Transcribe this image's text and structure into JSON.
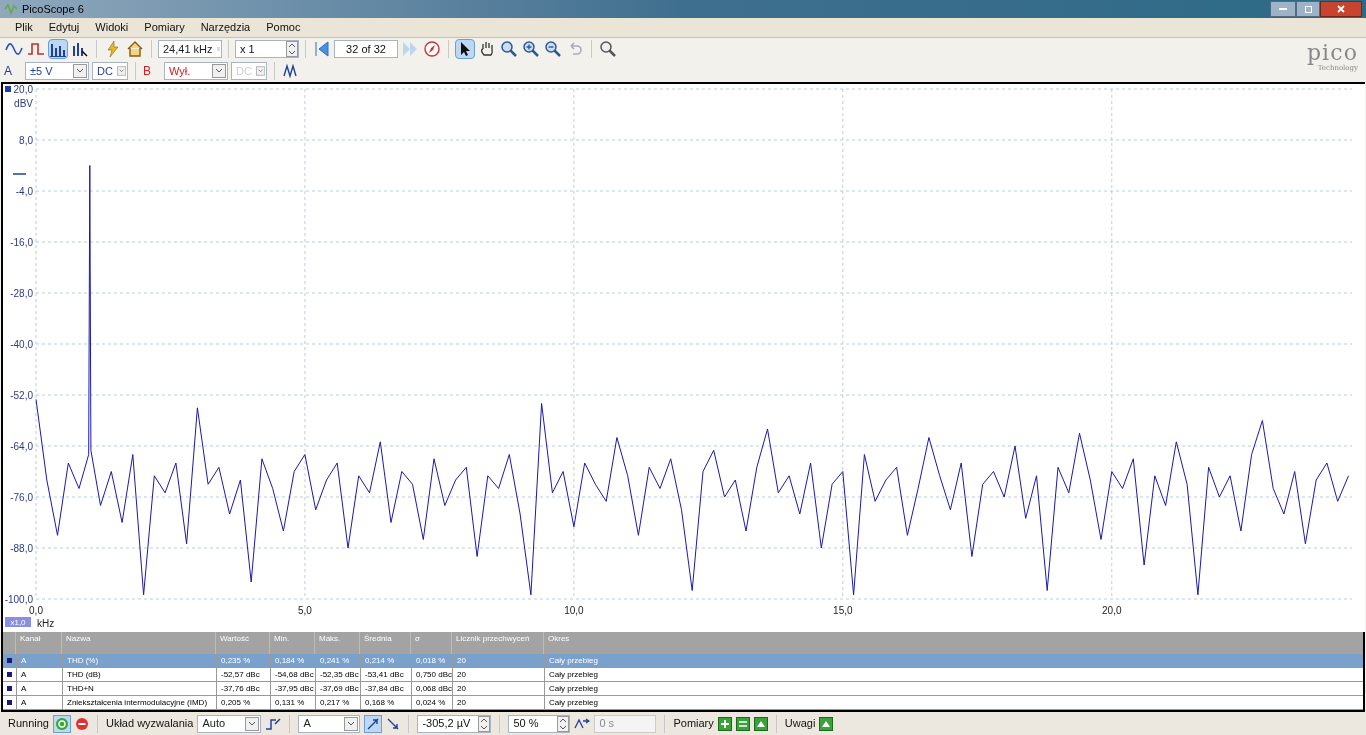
{
  "window": {
    "title": "PicoScope 6"
  },
  "menu": [
    "Plik",
    "Edytuj",
    "Widoki",
    "Pomiary",
    "Narzędzia",
    "Pomoc"
  ],
  "toolbar": {
    "modes": [
      {
        "kind": "scope",
        "selected": false
      },
      {
        "kind": "persistence",
        "selected": false
      },
      {
        "kind": "spectrum",
        "selected": true
      }
    ],
    "timebase": "24,41 kHz",
    "zoom": "x 1",
    "buffer": "32 of 32",
    "tools": [
      {
        "kind": "pointer",
        "selected": true
      },
      {
        "kind": "hand",
        "selected": false
      },
      {
        "kind": "zoom",
        "selected": false
      },
      {
        "kind": "zoom-in",
        "selected": false
      },
      {
        "kind": "zoom-out",
        "selected": false
      },
      {
        "kind": "undo",
        "selected": false
      }
    ]
  },
  "channels": [
    {
      "name": "A",
      "color": "#1e3fa0",
      "range": "±5 V",
      "coupling": "DC",
      "coupling_disabled": false
    },
    {
      "name": "B",
      "color": "#cc2222",
      "range": "Wył.",
      "coupling": "DC",
      "coupling_disabled": true
    }
  ],
  "logo": {
    "name": "pico",
    "tagline": "Technology"
  },
  "plot": {
    "zoom_badge": "x1,0",
    "chart_data": {
      "type": "line",
      "grid": true,
      "xlabel": "kHz",
      "ylabel": "dBV",
      "xlim": [
        0,
        24.41
      ],
      "ylim": [
        -100,
        20
      ],
      "xticks": [
        {
          "value": 0,
          "label": "0,0"
        },
        {
          "value": 5,
          "label": "5,0"
        },
        {
          "value": 10,
          "label": "10,0"
        },
        {
          "value": 15,
          "label": "15,0"
        },
        {
          "value": 20,
          "label": "20,0"
        }
      ],
      "yticks": [
        {
          "value": 20,
          "label": "20,0"
        },
        {
          "value": 8,
          "label": "8,0"
        },
        {
          "value": -4,
          "label": "-4,0"
        },
        {
          "value": -16,
          "label": "-16,0"
        },
        {
          "value": -28,
          "label": "-28,0"
        },
        {
          "value": -40,
          "label": "-40,0"
        },
        {
          "value": -52,
          "label": "-52,0"
        },
        {
          "value": -64,
          "label": "-64,0"
        },
        {
          "value": -76,
          "label": "-76,0"
        },
        {
          "value": -88,
          "label": "-88,0"
        },
        {
          "value": -100,
          "label": "-100,0"
        }
      ],
      "x": [
        0,
        0.2,
        0.4,
        0.6,
        0.8,
        0.98,
        1.0,
        1.02,
        1.2,
        1.4,
        1.6,
        1.8,
        2.0,
        2.2,
        2.4,
        2.6,
        2.8,
        3.0,
        3.2,
        3.4,
        3.6,
        3.8,
        4.0,
        4.2,
        4.4,
        4.6,
        4.8,
        5.0,
        5.2,
        5.4,
        5.6,
        5.8,
        6.0,
        6.2,
        6.4,
        6.6,
        6.8,
        7.0,
        7.2,
        7.4,
        7.6,
        7.8,
        8.0,
        8.2,
        8.4,
        8.6,
        8.8,
        9.0,
        9.2,
        9.4,
        9.6,
        9.8,
        10.0,
        10.2,
        10.4,
        10.6,
        10.8,
        11.0,
        11.2,
        11.4,
        11.6,
        11.8,
        12.0,
        12.2,
        12.4,
        12.6,
        12.8,
        13.0,
        13.2,
        13.4,
        13.6,
        13.8,
        14.0,
        14.2,
        14.4,
        14.6,
        14.8,
        15.0,
        15.2,
        15.4,
        15.6,
        15.8,
        16.0,
        16.2,
        16.4,
        16.6,
        16.8,
        17.0,
        17.2,
        17.4,
        17.6,
        17.8,
        18.0,
        18.2,
        18.4,
        18.6,
        18.8,
        19.0,
        19.2,
        19.4,
        19.6,
        19.8,
        20.0,
        20.2,
        20.4,
        20.6,
        20.8,
        21.0,
        21.2,
        21.4,
        21.6,
        21.8,
        22.0,
        22.2,
        22.4,
        22.6,
        22.8,
        23.0,
        23.2,
        23.4,
        23.6,
        23.8,
        24.0,
        24.2,
        24.4
      ],
      "series": [
        {
          "color": "#1a1aa8",
          "values": [
            -53,
            -72,
            -85,
            -68,
            -74,
            -66,
            2,
            -65,
            -78,
            -70,
            -82,
            -66,
            -99,
            -71,
            -75,
            -68,
            -87,
            -55,
            -73,
            -69,
            -80,
            -72,
            -96,
            -67,
            -74,
            -84,
            -70,
            -66,
            -79,
            -72,
            -68,
            -88,
            -71,
            -75,
            -63,
            -82,
            -70,
            -73,
            -86,
            -67,
            -78,
            -72,
            -69,
            -90,
            -71,
            -74,
            -66,
            -80,
            -99,
            -54,
            -75,
            -70,
            -83,
            -68,
            -73,
            -77,
            -62,
            -71,
            -85,
            -69,
            -74,
            -67,
            -79,
            -98,
            -70,
            -65,
            -76,
            -72,
            -84,
            -69,
            -60,
            -75,
            -71,
            -80,
            -68,
            -88,
            -73,
            -70,
            -99,
            -66,
            -77,
            -72,
            -69,
            -85,
            -74,
            -62,
            -71,
            -79,
            -68,
            -90,
            -73,
            -70,
            -76,
            -64,
            -81,
            -71,
            -98,
            -69,
            -75,
            -61,
            -72,
            -86,
            -70,
            -74,
            -67,
            -92,
            -71,
            -78,
            -63,
            -73,
            -99,
            -69,
            -76,
            -71,
            -84,
            -66,
            -58,
            -74,
            -80,
            -70,
            -87,
            -72,
            -68,
            -77,
            -71
          ]
        }
      ]
    }
  },
  "measurements": {
    "columns": [
      "Kanał",
      "Nazwa",
      "Wartość",
      "Min.",
      "Maks.",
      "Średnia",
      "σ",
      "Licznik przechwyceń",
      "Okres"
    ],
    "rows": [
      {
        "selected": true,
        "cells": [
          "A",
          "THD (%)",
          "0,235 %",
          "0,184 %",
          "0,241 %",
          "0,214 %",
          "0,018 %",
          "20",
          "Cały przebieg"
        ]
      },
      {
        "selected": false,
        "cells": [
          "A",
          "THD (dB)",
          "-52,57 dBc",
          "-54,68 dBc",
          "-52,35 dBc",
          "-53,41 dBc",
          "0,750 dBc",
          "20",
          "Cały przebieg"
        ]
      },
      {
        "selected": false,
        "cells": [
          "A",
          "THD+N",
          "-37,76 dBc",
          "-37,95 dBc",
          "-37,69 dBc",
          "-37,84 dBc",
          "0,068 dBc",
          "20",
          "Cały przebieg"
        ]
      },
      {
        "selected": false,
        "cells": [
          "A",
          "Zniekształcenia intermodulacyjne (IMD)",
          "0,205 %",
          "0,131 %",
          "0,217 %",
          "0,168 %",
          "0,024 %",
          "20",
          "Cały przebieg"
        ]
      }
    ]
  },
  "status_bar": {
    "run_state": "Running",
    "trigger_label": "Układ wyzwalania",
    "trigger_mode": "Auto",
    "trigger_channel": "A",
    "threshold": "-305,2 µV",
    "pretrigger": "50 %",
    "delay": "0 s",
    "measurements_label": "Pomiary",
    "notes_label": "Uwagi"
  }
}
